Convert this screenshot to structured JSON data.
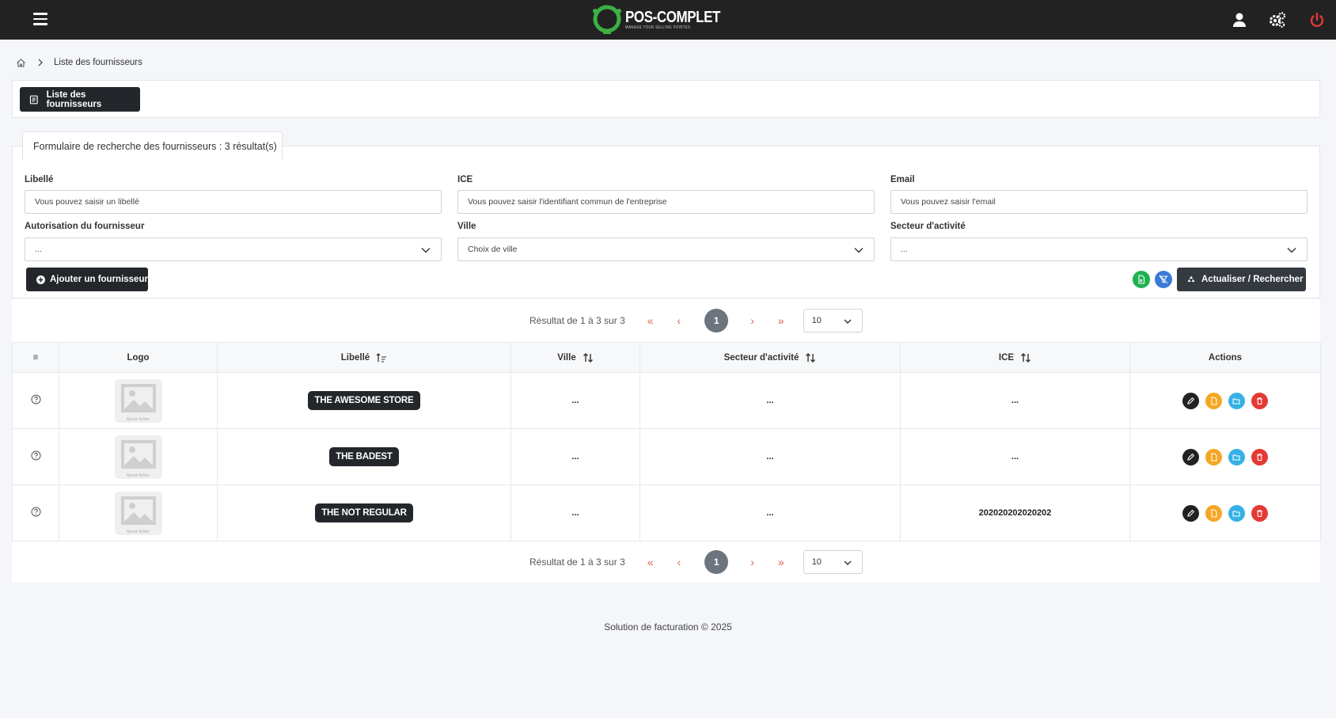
{
  "app": {
    "name": "POS-COMPLET",
    "tagline": "MANAGE YOUR SELLING POINTES"
  },
  "breadcrumb": {
    "current": "Liste des fournisseurs"
  },
  "header": {
    "button_label": "Liste des fournisseurs"
  },
  "search": {
    "tab_title": "Formulaire de recherche des fournisseurs : 3 résultat(s)",
    "fields": {
      "libelle": {
        "label": "Libellé",
        "placeholder": "Vous pouvez saisir un libellé"
      },
      "ice": {
        "label": "ICE",
        "placeholder": "Vous pouvez saisir l'identifiant commun de l'entreprise"
      },
      "email": {
        "label": "Email",
        "placeholder": "Vous pouvez saisir l'email"
      },
      "autorisation": {
        "label": "Autorisation du fournisseur",
        "value": "..."
      },
      "ville": {
        "label": "Ville",
        "value": "Choix de ville"
      },
      "secteur": {
        "label": "Secteur d'activité",
        "value": "..."
      }
    },
    "add_button": "Ajouter un fournisseur",
    "refresh_button": "Actualiser / Rechercher"
  },
  "pagination": {
    "result_text": "Résultat de 1 à 3 sur 3",
    "first": "«",
    "prev": "‹",
    "current_page": "1",
    "next": "›",
    "last": "»",
    "page_size": "10"
  },
  "table": {
    "columns": [
      "≡",
      "Logo",
      "Libellé",
      "Ville",
      "Secteur d'activité",
      "ICE",
      "Actions"
    ],
    "rows": [
      {
        "libelle": "THE AWESOME STORE",
        "ville": "...",
        "secteur": "...",
        "ice": "...",
        "logo_caption": "Aucun fichier"
      },
      {
        "libelle": "THE BADEST",
        "ville": "...",
        "secteur": "...",
        "ice": "...",
        "logo_caption": "Aucun fichier"
      },
      {
        "libelle": "THE NOT REGULAR",
        "ville": "...",
        "secteur": "...",
        "ice": "202020202020202",
        "logo_caption": "Aucun fichier"
      }
    ]
  },
  "footer": {
    "text": "Solution de facturation © 2025"
  },
  "colors": {
    "topbar": "#222222",
    "dark_button": "#23272b",
    "excel_green": "#1fb14f",
    "filter_blue": "#3a7bd5",
    "edit": "#222222",
    "document": "#f5a623",
    "folder": "#36b1e6",
    "delete": "#e53935",
    "power": "#e53935"
  }
}
